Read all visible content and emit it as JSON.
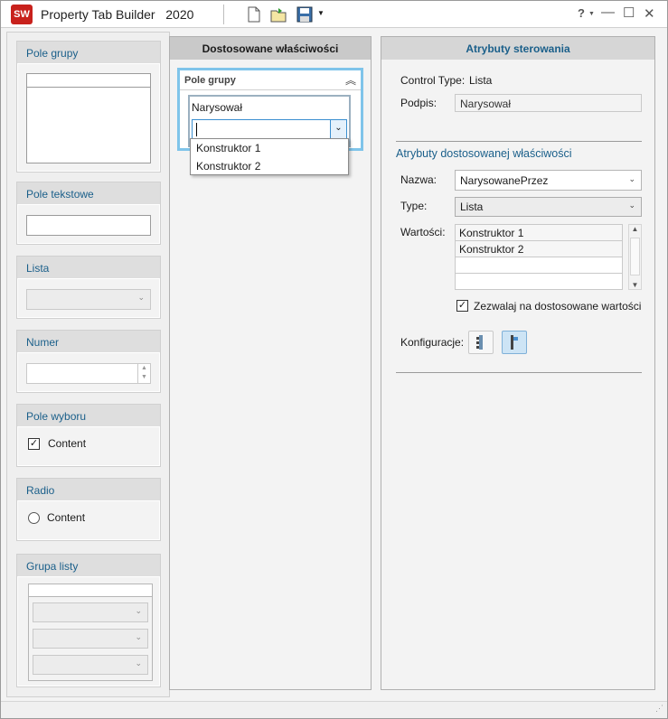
{
  "app": {
    "logo": "SW",
    "title": "Property Tab Builder   2020"
  },
  "toolbar": {
    "new_icon": "new-file-icon",
    "open_icon": "open-folder-icon",
    "save_icon": "save-disk-icon",
    "dropdown_icon": "dropdown-arrow-icon",
    "help": "?",
    "minimize": "—",
    "maximize": "☐",
    "close": "✕"
  },
  "palette": {
    "group_box": "Pole grupy",
    "text_box": "Pole tekstowe",
    "list": "Lista",
    "number": "Numer",
    "checkbox": {
      "title": "Pole wyboru",
      "label": "Content",
      "checked": true
    },
    "radio": {
      "title": "Radio",
      "label": "Content"
    },
    "list_group": "Grupa listy"
  },
  "custom": {
    "header": "Dostosowane właściwości",
    "group_title": "Pole grupy",
    "control_label": "Narysował",
    "dropdown_options": [
      "Konstruktor 1",
      "Konstruktor 2"
    ]
  },
  "attributes": {
    "header": "Atrybuty sterowania",
    "control_type_label": "Control Type:",
    "control_type_value": "Lista",
    "caption_label": "Podpis:",
    "caption_value": "Narysował",
    "custom_section": "Atrybuty dostosowanej właściwości",
    "name_label": "Nazwa:",
    "name_value": "NarysowanePrzez",
    "type_label": "Type:",
    "type_value": "Lista",
    "values_label": "Wartości:",
    "values": [
      "Konstruktor 1",
      "Konstruktor 2",
      "",
      ""
    ],
    "allow_custom_label": "Zezwalaj na dostosowane wartości",
    "allow_custom_checked": true,
    "config_label": "Konfiguracje:"
  },
  "colors": {
    "accent": "#1a5f8a",
    "selection": "#7fc4ea"
  }
}
